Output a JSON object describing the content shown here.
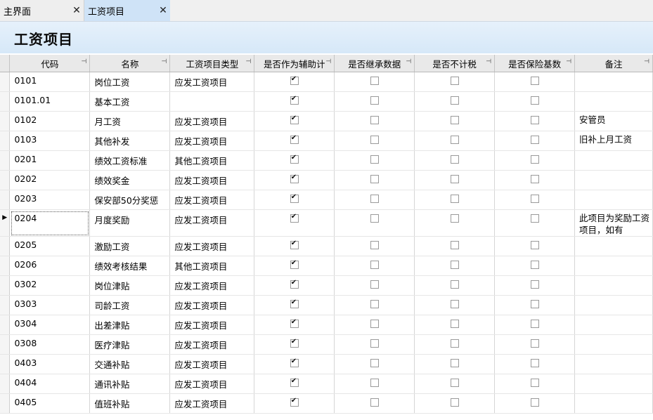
{
  "tabs": [
    {
      "label": "主界面",
      "close": "✕",
      "active": false
    },
    {
      "label": "工资项目",
      "close": "✕",
      "active": true
    }
  ],
  "header": {
    "title": "工资项目"
  },
  "grid": {
    "columns": [
      {
        "label": "代码",
        "pin": "⊣"
      },
      {
        "label": "名称",
        "pin": "⊣"
      },
      {
        "label": "工资项目类型",
        "pin": "⊣"
      },
      {
        "label": "是否作为辅助计",
        "pin": "⊣"
      },
      {
        "label": "是否继承数据",
        "pin": "⊣"
      },
      {
        "label": "是否不计税",
        "pin": "⊣"
      },
      {
        "label": "是否保险基数",
        "pin": "⊣"
      },
      {
        "label": "备注",
        "pin": "⊣"
      }
    ],
    "current_row_marker": "▶",
    "rows": [
      {
        "code": "0101",
        "name": "岗位工资",
        "type": "应发工资项目",
        "aux": true,
        "inherit": false,
        "notax": false,
        "insurance": false,
        "remark": ""
      },
      {
        "code": "0101.01",
        "name": "基本工资",
        "type": "",
        "aux": true,
        "inherit": false,
        "notax": false,
        "insurance": false,
        "remark": ""
      },
      {
        "code": "0102",
        "name": "月工资",
        "type": "应发工资项目",
        "aux": true,
        "inherit": false,
        "notax": false,
        "insurance": false,
        "remark": "安管员"
      },
      {
        "code": "0103",
        "name": "其他补发",
        "type": "应发工资项目",
        "aux": true,
        "inherit": false,
        "notax": false,
        "insurance": false,
        "remark": "旧补上月工资"
      },
      {
        "code": "0201",
        "name": "绩效工资标准",
        "type": "其他工资项目",
        "aux": true,
        "inherit": false,
        "notax": false,
        "insurance": false,
        "remark": ""
      },
      {
        "code": "0202",
        "name": "绩效奖金",
        "type": "应发工资项目",
        "aux": true,
        "inherit": false,
        "notax": false,
        "insurance": false,
        "remark": ""
      },
      {
        "code": "0203",
        "name": "保安部50分奖惩",
        "type": "应发工资项目",
        "aux": true,
        "inherit": false,
        "notax": false,
        "insurance": false,
        "remark": ""
      },
      {
        "code": "0204",
        "name": "月度奖励",
        "type": "应发工资项目",
        "aux": true,
        "inherit": false,
        "notax": false,
        "insurance": false,
        "remark": "此项目为奖励工资项目，如有",
        "current": true
      },
      {
        "code": "0205",
        "name": "激励工资",
        "type": "应发工资项目",
        "aux": true,
        "inherit": false,
        "notax": false,
        "insurance": false,
        "remark": ""
      },
      {
        "code": "0206",
        "name": "绩效考核结果",
        "type": "其他工资项目",
        "aux": true,
        "inherit": false,
        "notax": false,
        "insurance": false,
        "remark": ""
      },
      {
        "code": "0302",
        "name": "岗位津贴",
        "type": "应发工资项目",
        "aux": true,
        "inherit": false,
        "notax": false,
        "insurance": false,
        "remark": ""
      },
      {
        "code": "0303",
        "name": "司龄工资",
        "type": "应发工资项目",
        "aux": true,
        "inherit": false,
        "notax": false,
        "insurance": false,
        "remark": ""
      },
      {
        "code": "0304",
        "name": "出差津贴",
        "type": "应发工资项目",
        "aux": true,
        "inherit": false,
        "notax": false,
        "insurance": false,
        "remark": ""
      },
      {
        "code": "0308",
        "name": "医疗津贴",
        "type": "应发工资项目",
        "aux": true,
        "inherit": false,
        "notax": false,
        "insurance": false,
        "remark": ""
      },
      {
        "code": "0403",
        "name": "交通补贴",
        "type": "应发工资项目",
        "aux": true,
        "inherit": false,
        "notax": false,
        "insurance": false,
        "remark": ""
      },
      {
        "code": "0404",
        "name": "通讯补贴",
        "type": "应发工资项目",
        "aux": true,
        "inherit": false,
        "notax": false,
        "insurance": false,
        "remark": ""
      },
      {
        "code": "0405",
        "name": "值班补贴",
        "type": "应发工资项目",
        "aux": true,
        "inherit": false,
        "notax": false,
        "insurance": false,
        "remark": ""
      }
    ]
  }
}
